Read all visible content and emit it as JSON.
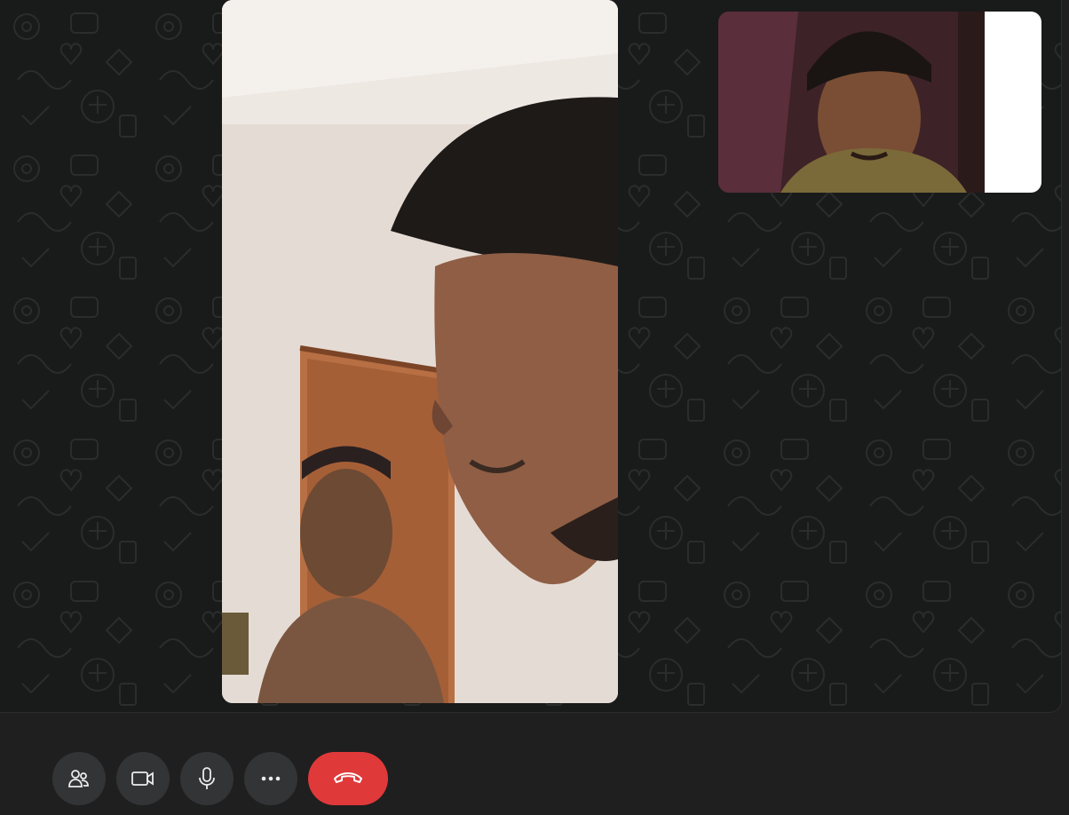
{
  "call": {
    "main_participant": "remote-video",
    "self_participant": "self-view"
  },
  "controls": {
    "participants_icon": "participants-icon",
    "camera_icon": "video-camera-icon",
    "mic_icon": "microphone-icon",
    "more_icon": "more-options-icon",
    "end_icon": "hang-up-icon"
  },
  "colors": {
    "background": "#191a1a",
    "control_bar": "#1f1f1f",
    "button": "#333435",
    "end_call": "#e0393a"
  }
}
